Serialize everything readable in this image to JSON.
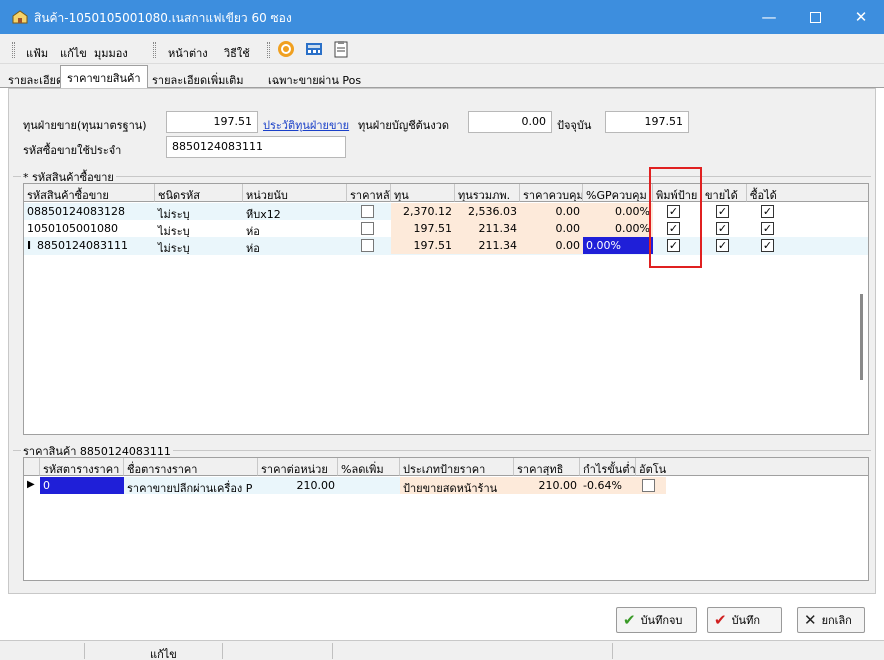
{
  "window": {
    "title": "สินค้า-1050105001080.เนสกาแฟเขียว 60 ซอง",
    "accent": "#3d8ede"
  },
  "toolbar": {
    "menus": [
      "แฟ้ม",
      "แก้ไข",
      "มุมมอง"
    ],
    "menus2": [
      "หน้าต่าง",
      "วิธีใช้"
    ]
  },
  "tabs": [
    "รายละเอียด",
    "ราคาขายสินค้า",
    "รายละเอียดเพิ่มเติม",
    "เฉพาะขายผ่าน Pos"
  ],
  "form": {
    "std_cost_label": "ทุนฝ่ายขาย(ทุนมาตรฐาน)",
    "std_cost_value": "197.51",
    "cost_history_link": "ประวัติทุนฝ่ายขาย",
    "opening_cost_label": "ทุนฝ่ายบัญชีต้นงวด",
    "opening_cost_value": "0.00",
    "current_label": "ปัจจุบัน",
    "current_value": "197.51",
    "regular_code_label": "รหัสซื้อขายใช้ประจำ",
    "regular_code_value": "8850124083111"
  },
  "codes_group": {
    "label": "* รหัสสินค้าซื้อขาย",
    "columns": [
      "รหัสสินค้าซื้อขาย",
      "ชนิดรหัส",
      "หน่วยนับ",
      "ราคาหลัก",
      "ทุน",
      "ทุนรวมภพ.",
      "ราคาควบคุม",
      "%GPควบคุม",
      "พิมพ์ป้าย",
      "ขายได้",
      "ซื้อได้"
    ],
    "rows": [
      {
        "code": "08850124083128",
        "type": "ไม่ระบุ",
        "unit": "หีบx12",
        "main": false,
        "cost": "2,370.12",
        "cost_vat": "2,536.03",
        "ctrl_price": "0.00",
        "gp": "0.00%",
        "print": true,
        "sell": true,
        "buy": true
      },
      {
        "code": "1050105001080",
        "type": "ไม่ระบุ",
        "unit": "ห่อ",
        "main": false,
        "cost": "197.51",
        "cost_vat": "211.34",
        "ctrl_price": "0.00",
        "gp": "0.00%",
        "print": true,
        "sell": true,
        "buy": true
      },
      {
        "code": "8850124083111",
        "type": "ไม่ระบุ",
        "unit": "ห่อ",
        "main": false,
        "cost": "197.51",
        "cost_vat": "211.34",
        "ctrl_price": "0.00",
        "gp": "0.00%",
        "print": true,
        "sell": true,
        "buy": true
      }
    ]
  },
  "price_group": {
    "label": "ราคาสินค้า 8850124083111",
    "columns": [
      "รหัสตารางราคา",
      "ชื่อตารางราคา",
      "ราคาต่อหน่วย",
      "%ลดเพิ่ม",
      "ประเภทป้ายราคา",
      "ราคาสุทธิ",
      "กำไรขั้นต่ำ",
      "อัตโน"
    ],
    "rows": [
      {
        "code": "0",
        "name": "ราคาขายปลีกผ่านเครื่อง P",
        "unit_price": "210.00",
        "discount": "",
        "label_type": "ป้ายขายสดหน้าร้าน",
        "net": "210.00",
        "min_profit": "-0.64%",
        "auto": false
      }
    ]
  },
  "buttons": {
    "save_close": "บันทึกจบ",
    "save": "บันทึก",
    "cancel": "ยกเลิก"
  },
  "status": {
    "mode": "แก้ไข"
  }
}
